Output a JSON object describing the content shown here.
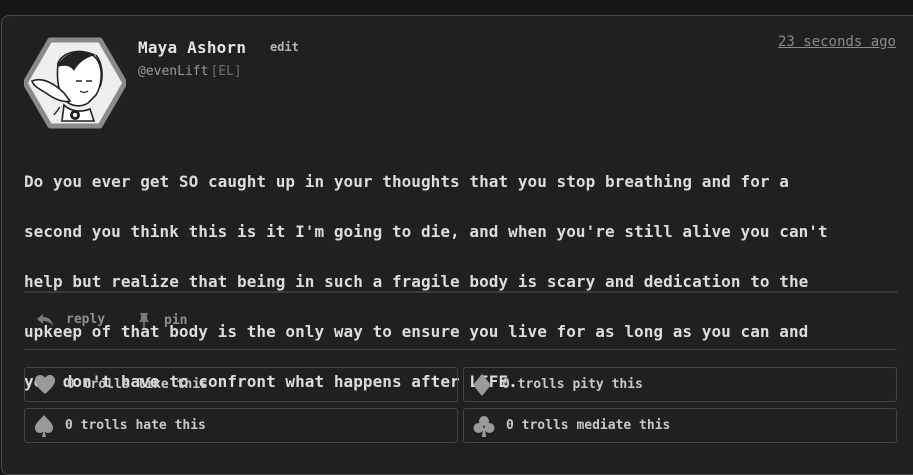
{
  "post": {
    "author": {
      "name": "Maya Ashorn",
      "edit_label": "edit",
      "handle": "@evenLift",
      "flair": "[EL]"
    },
    "timestamp": "23 seconds ago",
    "lines": [
      "Do you ever get SO caught up in your thoughts that you stop breathing and for a",
      "second you think this is it I'm going to die, and when you're still alive you can't",
      "help but realize that being in such a fragile body is scary and dedication to the",
      "upkeep of that body is the only way to ensure you live for as long as you can and",
      "you don't have to confront what happens after LIFE."
    ],
    "actions": {
      "reply_label": "reply",
      "pin_label": "pin"
    },
    "reactions": {
      "like": "0 trolls like this",
      "pity": "0 trolls pity this",
      "hate": "0 trolls hate this",
      "mediate": "0 trolls mediate this"
    }
  },
  "icons": {
    "avatar": "hexagon-avatar",
    "reply": "reply-arrow-icon",
    "pin": "pin-icon",
    "like": "heart-icon",
    "pity": "diamond-icon",
    "hate": "spade-icon",
    "mediate": "club-icon"
  },
  "colors": {
    "page_bg": "#161616",
    "card_bg": "#202020",
    "text": "#dcdcdc",
    "muted": "#8e8e8e",
    "border": "#444444"
  }
}
